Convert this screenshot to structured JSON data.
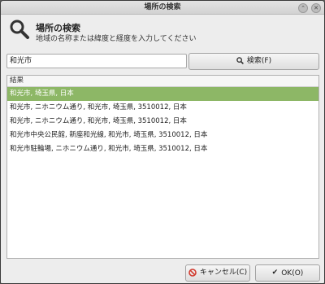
{
  "window": {
    "title": "場所の検索"
  },
  "header": {
    "title": "場所の検索",
    "subtitle": "地域の名称または緯度と経度を入力してください"
  },
  "search": {
    "value": "和光市",
    "button_label": "検索(F)"
  },
  "results": {
    "column_header": "結果",
    "rows": [
      "和光市, 埼玉県, 日本",
      "和光市, ニホニウム通り, 和光市, 埼玉県, 3510012, 日本",
      "和光市, ニホニウム通り, 和光市, 埼玉県, 3510012, 日本",
      "和光市中央公民館, 新座和光線, 和光市, 埼玉県, 3510012, 日本",
      "和光市駐輪場, ニホニウム通り, 和光市, 埼玉県, 3510012, 日本"
    ],
    "selected_index": 0
  },
  "buttons": {
    "cancel": "キャンセル(C)",
    "ok": "OK(O)"
  },
  "colors": {
    "selection": "#8db766",
    "cancel_icon": "#d23b2f"
  }
}
